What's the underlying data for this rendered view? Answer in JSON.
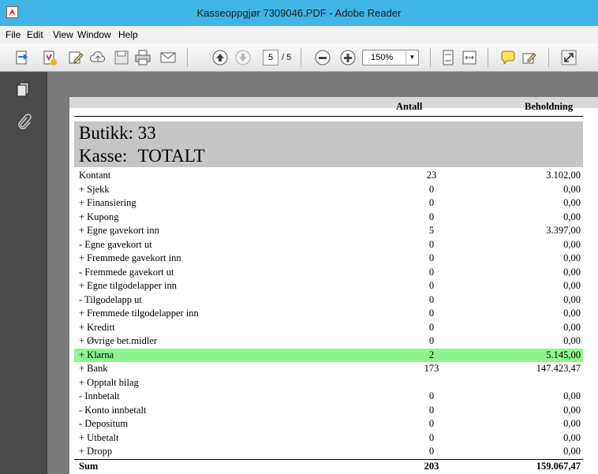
{
  "window": {
    "title": "Kasseoppgjør 7309046.PDF - Adobe Reader"
  },
  "menu": [
    "File",
    "Edit",
    "View",
    "Window",
    "Help"
  ],
  "toolbar": {
    "page_current": "5",
    "page_total": "/ 5",
    "zoom": "150%"
  },
  "report": {
    "col_antall": "Antall",
    "col_beholdning": "Beholdning",
    "butikk": "Butikk: 33",
    "kasse": "Kasse: TOTALT",
    "rows": [
      {
        "label": "Kontant",
        "count": "23",
        "value": "3.102,00"
      },
      {
        "label": "+ Sjekk",
        "count": "0",
        "value": "0,00"
      },
      {
        "label": "+ Finansiering",
        "count": "0",
        "value": "0,00"
      },
      {
        "label": "+ Kupong",
        "count": "0",
        "value": "0,00"
      },
      {
        "label": "+ Egne gavekort inn",
        "count": "5",
        "value": "3.397,00"
      },
      {
        "label": "- Egne gavekort ut",
        "count": "0",
        "value": "0,00"
      },
      {
        "label": "+ Fremmede gavekort inn",
        "count": "0",
        "value": "0,00"
      },
      {
        "label": "- Fremmede gavekort ut",
        "count": "0",
        "value": "0,00"
      },
      {
        "label": "+ Egne tilgodelapper inn",
        "count": "0",
        "value": "0,00"
      },
      {
        "label": "- Tilgodelapp ut",
        "count": "0",
        "value": "0,00"
      },
      {
        "label": "+ Fremmede tilgodelapper inn",
        "count": "0",
        "value": "0,00"
      },
      {
        "label": "+ Kreditt",
        "count": "0",
        "value": "0,00"
      },
      {
        "label": "+ Øvrige bet.midler",
        "count": "0",
        "value": "0,00"
      },
      {
        "label": "+  Klarna",
        "count": "2",
        "value": "5.145,00",
        "highlight": true
      },
      {
        "label": "+ Bank",
        "count": "173",
        "value": "147.423,47"
      },
      {
        "label": "+ Opptalt bilag",
        "count": "",
        "value": ""
      },
      {
        "label": "- Innbetalt",
        "count": "0",
        "value": "0,00"
      },
      {
        "label": "- Konto innbetalt",
        "count": "0",
        "value": "0,00"
      },
      {
        "label": "- Depositum",
        "count": "0",
        "value": "0,00"
      },
      {
        "label": "+ Utbetalt",
        "count": "0",
        "value": "0,00"
      },
      {
        "label": "+ Dropp",
        "count": "0",
        "value": "0,00"
      }
    ],
    "sum": {
      "label": "Sum",
      "count": "203",
      "value": "159.067,47"
    }
  }
}
